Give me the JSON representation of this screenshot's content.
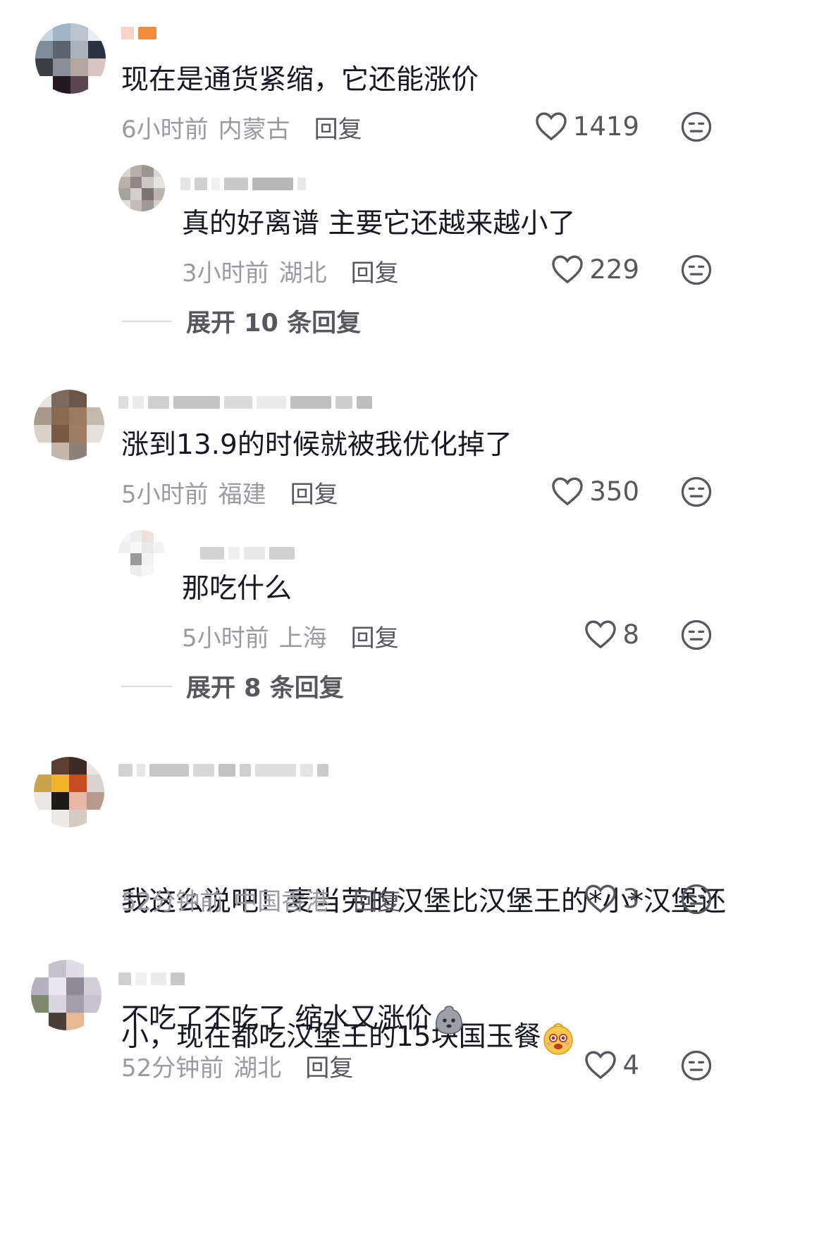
{
  "comments": [
    {
      "text": "现在是通货紧缩，它还能涨价",
      "time": "6小时前",
      "region": "内蒙古",
      "reply": "回复",
      "likes": "1419",
      "replies": [
        {
          "text": "真的好离谱 主要它还越来越小了",
          "time": "3小时前",
          "region": "湖北",
          "reply": "回复",
          "likes": "229"
        }
      ],
      "expand": "展开 10 条回复"
    },
    {
      "text": "涨到13.9的时候就被我优化掉了",
      "time": "5小时前",
      "region": "福建",
      "reply": "回复",
      "likes": "350",
      "replies": [
        {
          "text": "那吃什么",
          "time": "5小时前",
          "region": "上海",
          "reply": "回复",
          "likes": "8"
        }
      ],
      "expand": "展开 8 条回复"
    },
    {
      "text_line1": "我这么说吧！麦当劳的汉堡比汉堡王的*小*汉堡还",
      "text_line2": "小，现在都吃汉堡王的15块国玉餐",
      "emoji": "excited-emoji",
      "time": "52分钟前",
      "region": "中国香港",
      "reply": "回复",
      "likes": "3"
    },
    {
      "text": "不吃了不吃了 缩水又涨价",
      "emoji": "sad-blob-emoji",
      "time": "52分钟前",
      "region": "湖北",
      "reply": "回复",
      "likes": "4"
    }
  ],
  "icons": {
    "like": "heart-outline-icon",
    "dislike": "neutral-face-icon"
  },
  "colors": {
    "text_primary": "#161823",
    "text_meta": "#9a9ba1",
    "text_action": "#57585e"
  }
}
